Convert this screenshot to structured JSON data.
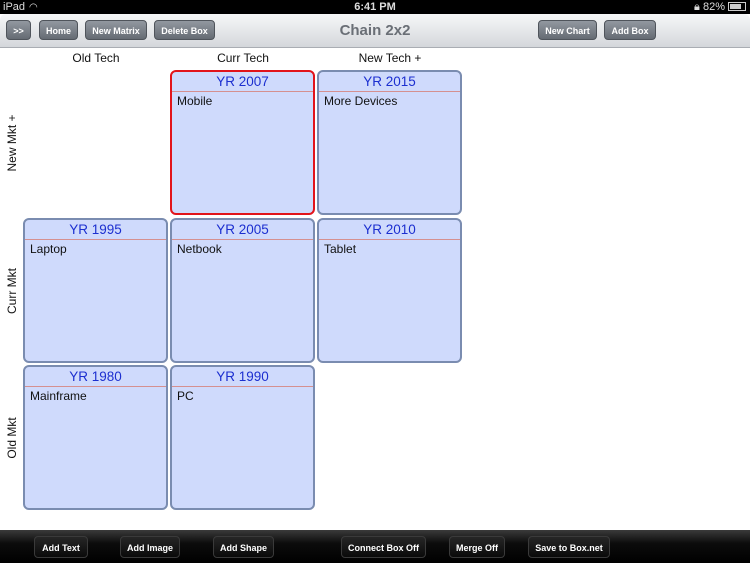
{
  "status_bar": {
    "device": "iPad",
    "time": "6:41 PM",
    "battery": "82%"
  },
  "nav": {
    "title": "Chain 2x2",
    "left_buttons": [
      ">>",
      "Home",
      "New Matrix",
      "Delete Box"
    ],
    "right_buttons": [
      "New Chart",
      "Add Box"
    ]
  },
  "matrix": {
    "columns": [
      "Old Tech",
      "Curr Tech",
      "New Tech +"
    ],
    "rows": [
      "New Mkt +",
      "Curr Mkt",
      "Old Mkt"
    ],
    "boxes": [
      {
        "year": "YR 2007",
        "text": "Mobile",
        "selected": true
      },
      {
        "year": "YR 2015",
        "text": "More Devices"
      },
      {
        "year": "YR 1995",
        "text": "Laptop"
      },
      {
        "year": "YR 2005",
        "text": "Netbook"
      },
      {
        "year": "YR 2010",
        "text": "Tablet"
      },
      {
        "year": "YR 1980",
        "text": "Mainframe"
      },
      {
        "year": "YR 1990",
        "text": "PC"
      }
    ]
  },
  "toolbar": {
    "buttons": [
      "Add Text",
      "Add Image",
      "Add Shape",
      "Connect Box Off",
      "Merge Off",
      "Save to Box.net"
    ]
  },
  "colors": {
    "selected_border": "#e2141b",
    "box_fill": "#cfdafc",
    "year_text": "#1c2fd0"
  }
}
